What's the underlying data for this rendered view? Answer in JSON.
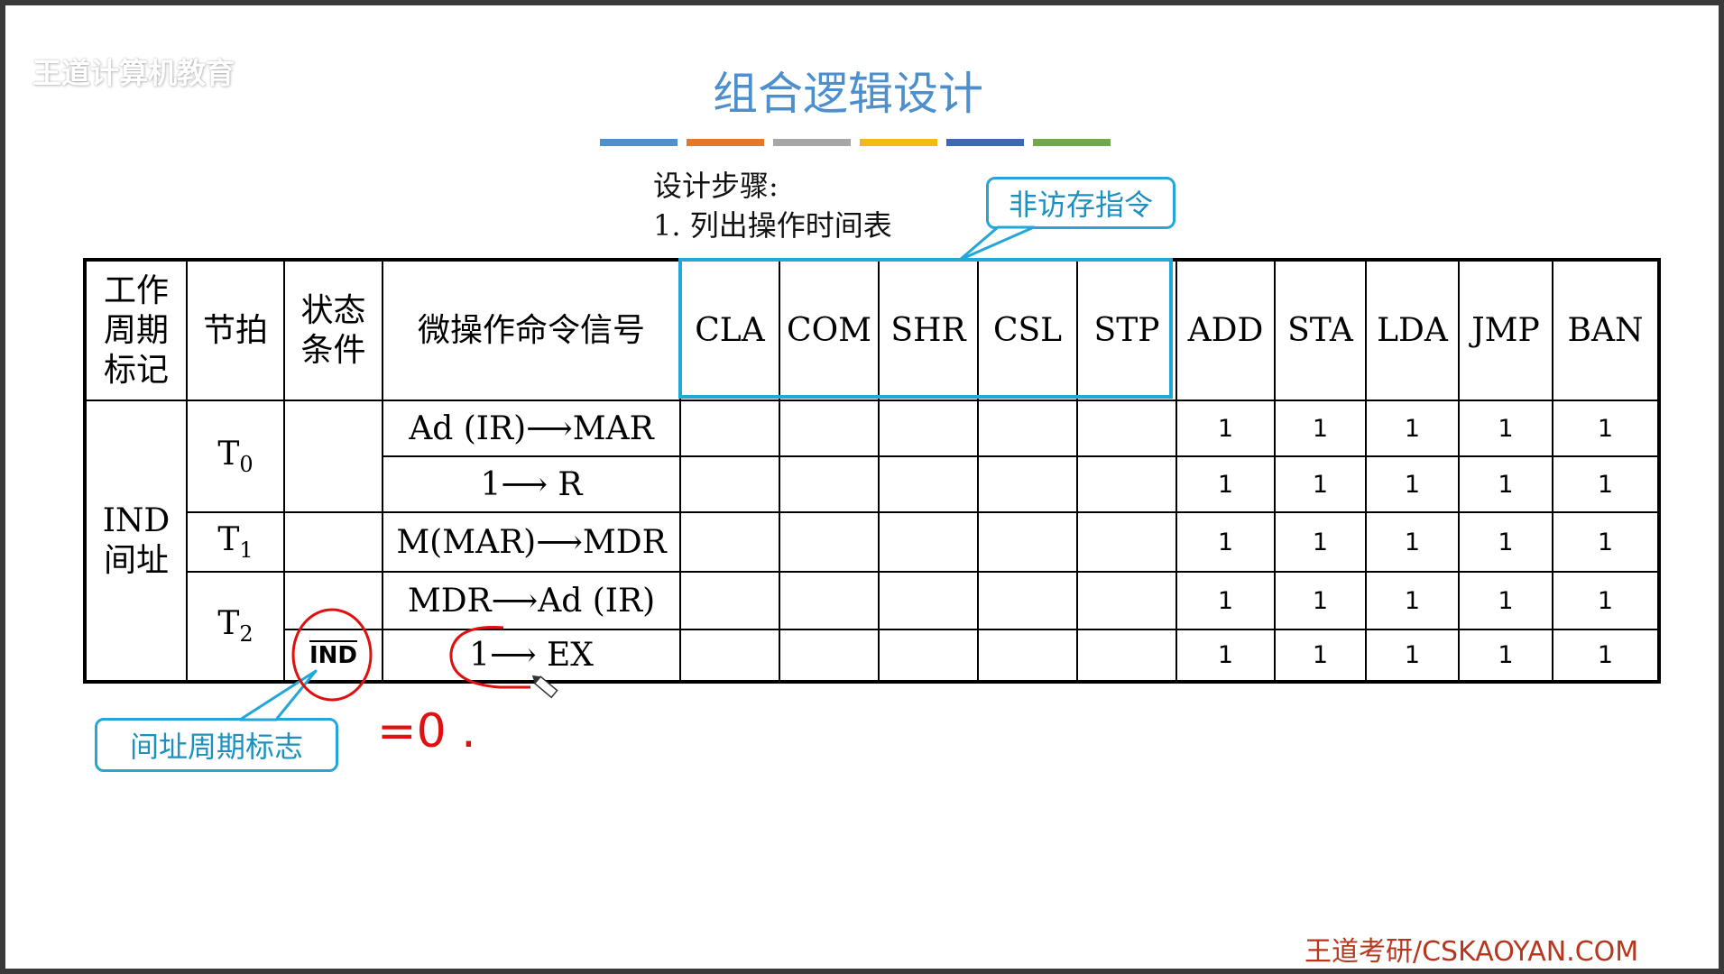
{
  "watermark": {
    "text": "王道计算机教育"
  },
  "title": "组合逻辑设计",
  "color_bar": [
    "#4e8fd0",
    "#e3782c",
    "#a6a6a6",
    "#f5b816",
    "#3e68b4",
    "#70aa46"
  ],
  "steps": {
    "heading": "设计步骤:",
    "step1": "1.  列出操作时间表"
  },
  "callouts": {
    "non_memory": "非访存指令",
    "indirect_flag": "间址周期标志"
  },
  "table": {
    "headers": {
      "cycle": [
        "工作",
        "周期",
        "标记"
      ],
      "beat": "节拍",
      "state": [
        "状态",
        "条件"
      ],
      "signal": "微操作命令信号",
      "instructions": [
        "CLA",
        "COM",
        "SHR",
        "CSL",
        "STP",
        "ADD",
        "STA",
        "LDA",
        "JMP",
        "BAN"
      ]
    },
    "cycle_label": [
      "IND",
      "间址"
    ],
    "beats": {
      "t0": "T",
      "t0_sub": "0",
      "t1": "T",
      "t1_sub": "1",
      "t2": "T",
      "t2_sub": "2"
    },
    "state_cond": "IND",
    "rows": [
      {
        "signal": "Ad (IR)⟶MAR",
        "values": [
          "",
          "",
          "",
          "",
          "",
          "1",
          "1",
          "1",
          "1",
          "1"
        ]
      },
      {
        "signal": "1⟶ R",
        "values": [
          "",
          "",
          "",
          "",
          "",
          "1",
          "1",
          "1",
          "1",
          "1"
        ]
      },
      {
        "signal": "M(MAR)⟶MDR",
        "values": [
          "",
          "",
          "",
          "",
          "",
          "1",
          "1",
          "1",
          "1",
          "1"
        ]
      },
      {
        "signal": "MDR⟶Ad (IR)",
        "values": [
          "",
          "",
          "",
          "",
          "",
          "1",
          "1",
          "1",
          "1",
          "1"
        ]
      },
      {
        "signal": "1⟶ EX",
        "values": [
          "",
          "",
          "",
          "",
          "",
          "1",
          "1",
          "1",
          "1",
          "1"
        ]
      }
    ]
  },
  "annotation": {
    "text": "=0 ."
  },
  "credit": "王道考研/CSKAOYAN.COM"
}
